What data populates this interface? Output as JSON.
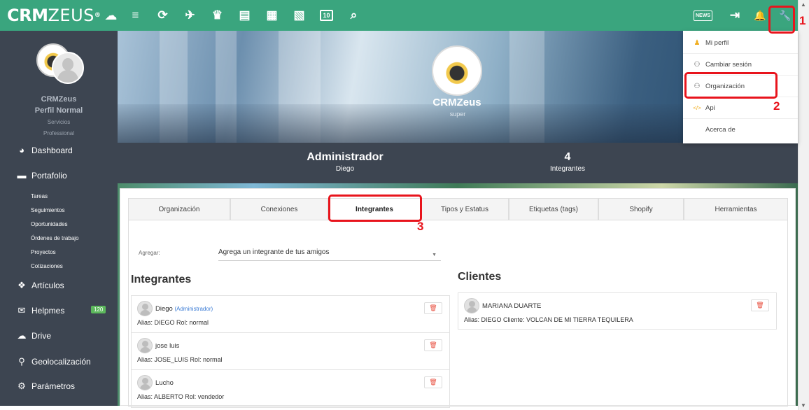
{
  "brand": {
    "name_bold": "CRM",
    "name_thin": "ZEUS",
    "reg": "®"
  },
  "toolbar": {
    "icons": [
      "menu-icon",
      "refresh-icon",
      "handshake-icon",
      "trophy-icon",
      "notes-icon",
      "calculator-icon",
      "document-icon",
      "calendar-icon",
      "search-icon"
    ],
    "glyphs": [
      "≡",
      "⟳",
      "✈",
      "♛",
      "▤",
      "▦",
      "▧",
      "▣",
      "⌕"
    ],
    "calendar_day": "10",
    "news": "NEWS",
    "logout": "⇥",
    "bell": "🔔",
    "wrench": "🔧"
  },
  "sidebar": {
    "user_name": "CRMZeus",
    "profile": "Perfil Normal",
    "line1": "Servicios",
    "line2": "Professional",
    "items": [
      {
        "label": "Dashboard",
        "icon": "◕"
      },
      {
        "label": "Portafolio",
        "icon": "▬"
      },
      {
        "label": "Artículos",
        "icon": "❖"
      },
      {
        "label": "Helpmes",
        "icon": "✉",
        "badge": "120"
      },
      {
        "label": "Drive",
        "icon": "☁"
      },
      {
        "label": "Geolocalización",
        "icon": "⚲"
      },
      {
        "label": "Parámetros",
        "icon": "⚙"
      }
    ],
    "subitems": [
      "Tareas",
      "Seguimientos",
      "Oportunidades",
      "Órdenes de trabajo",
      "Proyectos",
      "Cotizaciones"
    ]
  },
  "hero": {
    "name": "CRMZeus",
    "role": "super"
  },
  "stats": {
    "left_big": "Administrador",
    "left_small": "Diego",
    "right_big": "4",
    "right_small": "Integrantes"
  },
  "tabs": [
    "Organización",
    "Conexiones",
    "Integrantes",
    "Tipos y Estatus",
    "Etiquetas (tags)",
    "Shopify",
    "Herramientas"
  ],
  "agregar": {
    "label": "Agregar:",
    "value": "Agrega un integrante de tus amigos"
  },
  "integrantes": {
    "title": "Integrantes",
    "rows": [
      {
        "name": "Diego",
        "role": "(Administrador)",
        "alias": "Alias: DIEGO Rol: normal"
      },
      {
        "name": "jose luis",
        "role": "",
        "alias": "Alias: JOSE_LUIS Rol: normal"
      },
      {
        "name": "Lucho",
        "role": "",
        "alias": "Alias: ALBERTO Rol: vendedor"
      }
    ]
  },
  "clientes": {
    "title": "Clientes",
    "rows": [
      {
        "name": "MARIANA DUARTE",
        "alias": "Alias: DIEGO Cliente: VOLCAN DE MI TIERRA TEQUILERA"
      }
    ]
  },
  "dropdown": {
    "items": [
      {
        "label": "Mi perfil",
        "icon": "♟",
        "color": "#f0ad1e"
      },
      {
        "label": "Cambiar sesión",
        "icon": "⚇",
        "color": "#555555"
      },
      {
        "label": "Organización",
        "icon": "⚇",
        "color": "#555555"
      },
      {
        "label": "Api",
        "icon": "</>",
        "color": "#f0ad1e"
      },
      {
        "label": "Acerca de",
        "icon": "",
        "color": "#555555"
      }
    ]
  },
  "annotations": [
    "1",
    "2",
    "3"
  ],
  "colors": {
    "topbar": "#3aa57e",
    "sidebar": "#3d4551",
    "annotation": "#e8141c",
    "badge": "#5cb85c"
  }
}
